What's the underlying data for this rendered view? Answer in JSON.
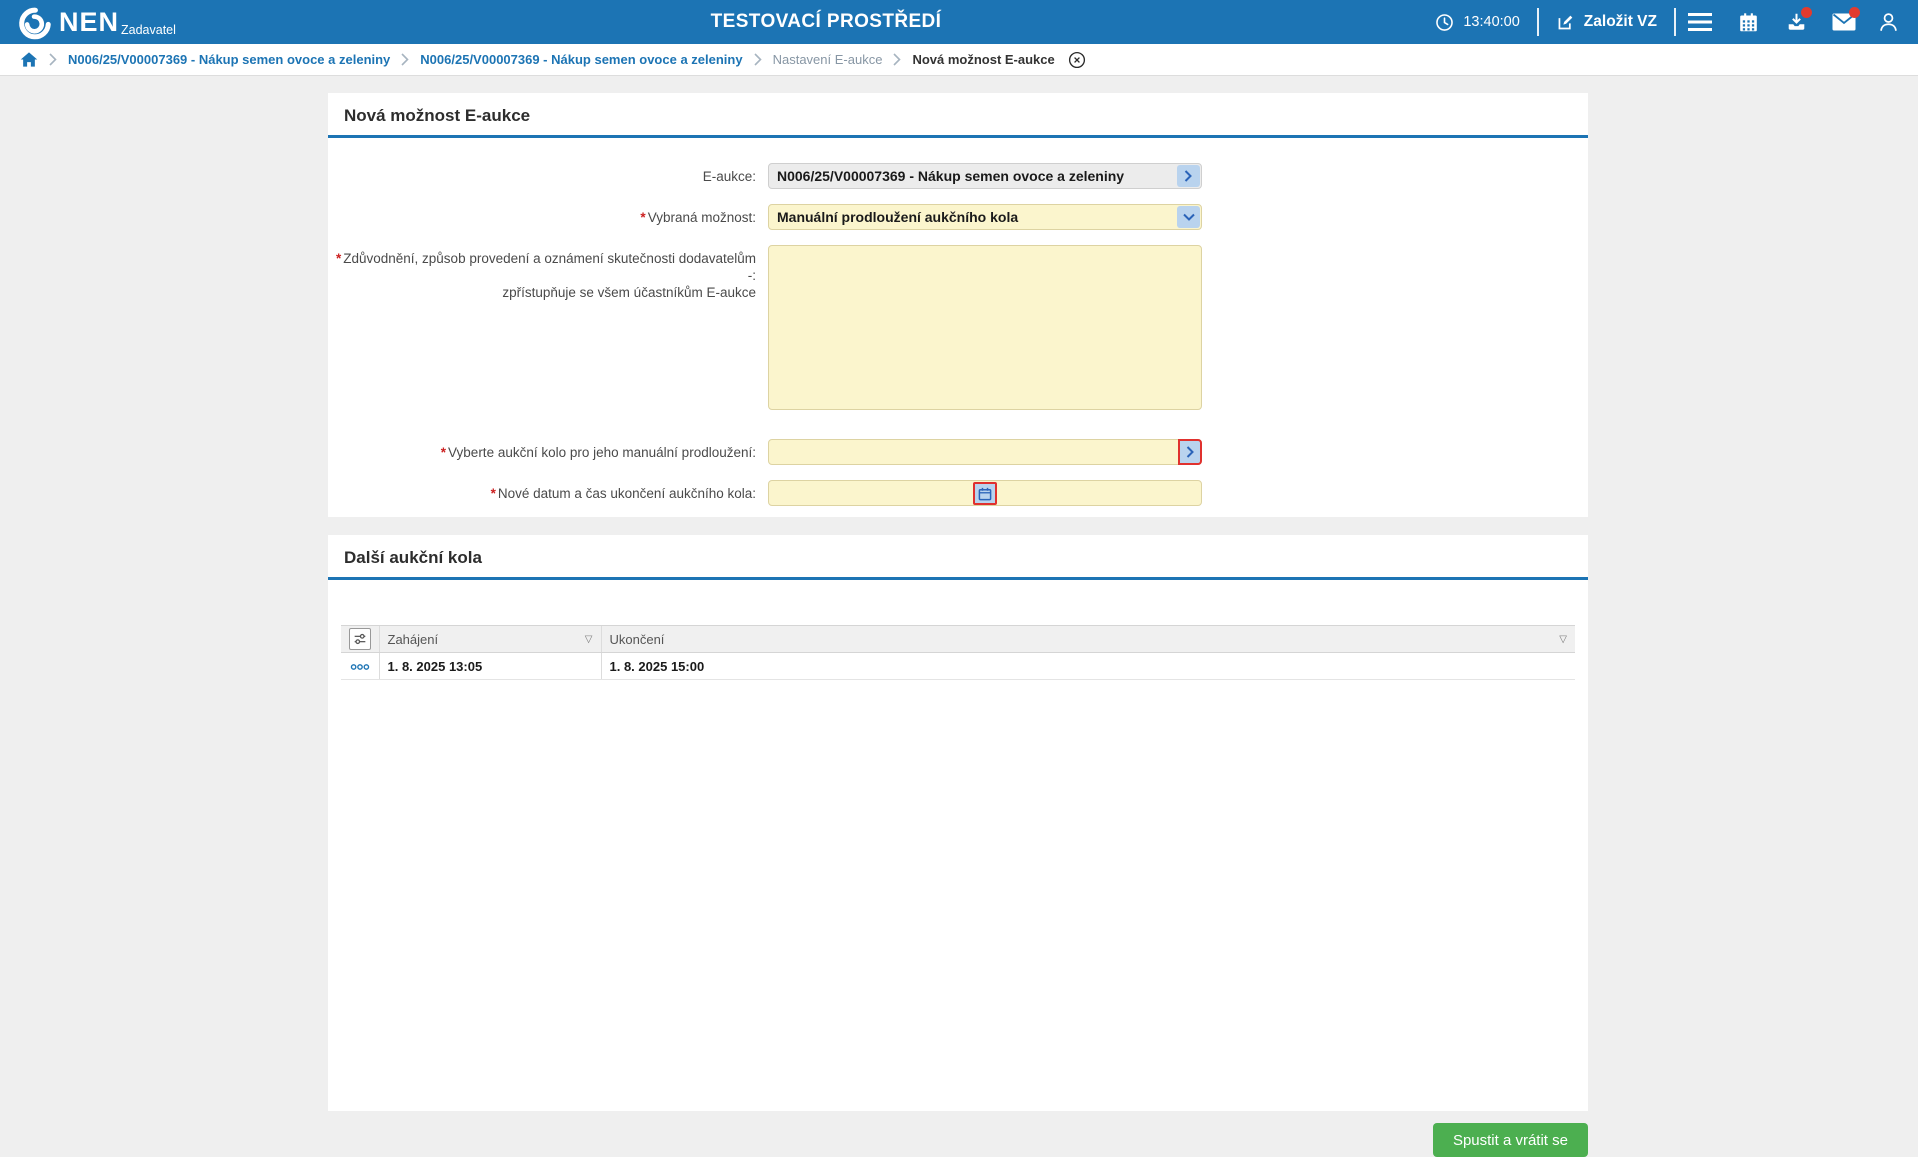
{
  "header": {
    "brand": "NEN",
    "brand_sub": "Zadavatel",
    "environment": "TESTOVACÍ PROSTŘEDÍ",
    "time": "13:40:00",
    "create_vz": "Založit VZ"
  },
  "breadcrumb": {
    "items": [
      "N006/25/V00007369 - Nákup semen ovoce a zeleniny",
      "N006/25/V00007369 - Nákup semen ovoce a zeleniny",
      "Nastavení E-aukce",
      "Nová možnost E-aukce"
    ]
  },
  "form": {
    "title": "Nová možnost E-aukce",
    "required_mark": "*",
    "eaukce_label": "E-aukce:",
    "eaukce_value": "N006/25/V00007369 - Nákup semen ovoce a zeleniny",
    "option_label": "Vybraná možnost:",
    "option_value": "Manuální prodloužení aukčního kola",
    "justification_label_1": "Zdůvodnění, způsob provedení a oznámení skutečnosti dodavatelům -:",
    "justification_label_2": "zpřístupňuje se všem účastníkům E-aukce",
    "justification_value": "",
    "round_label": "Vyberte aukční kolo pro jeho manuální prodloužení:",
    "round_value": "",
    "datetime_label": "Nové datum a čas ukončení aukčního kola:",
    "datetime_value": ""
  },
  "rounds": {
    "title": "Další aukční kola",
    "columns": [
      "Zahájení",
      "Ukončení"
    ],
    "sort_glyph": "▽",
    "rows": [
      {
        "zahajeni": "1. 8. 2025 13:05",
        "ukonceni": "1. 8. 2025 15:00"
      }
    ]
  },
  "footer": {
    "submit": "Spustit a vrátit se"
  },
  "colors": {
    "header_blue": "#1C74B4",
    "accent_blue": "#1C74B4",
    "field_yellow": "#FBF5CD",
    "button_green": "#4CAF50",
    "highlight_red": "#E0312E",
    "notification_red": "#E23B2E"
  }
}
